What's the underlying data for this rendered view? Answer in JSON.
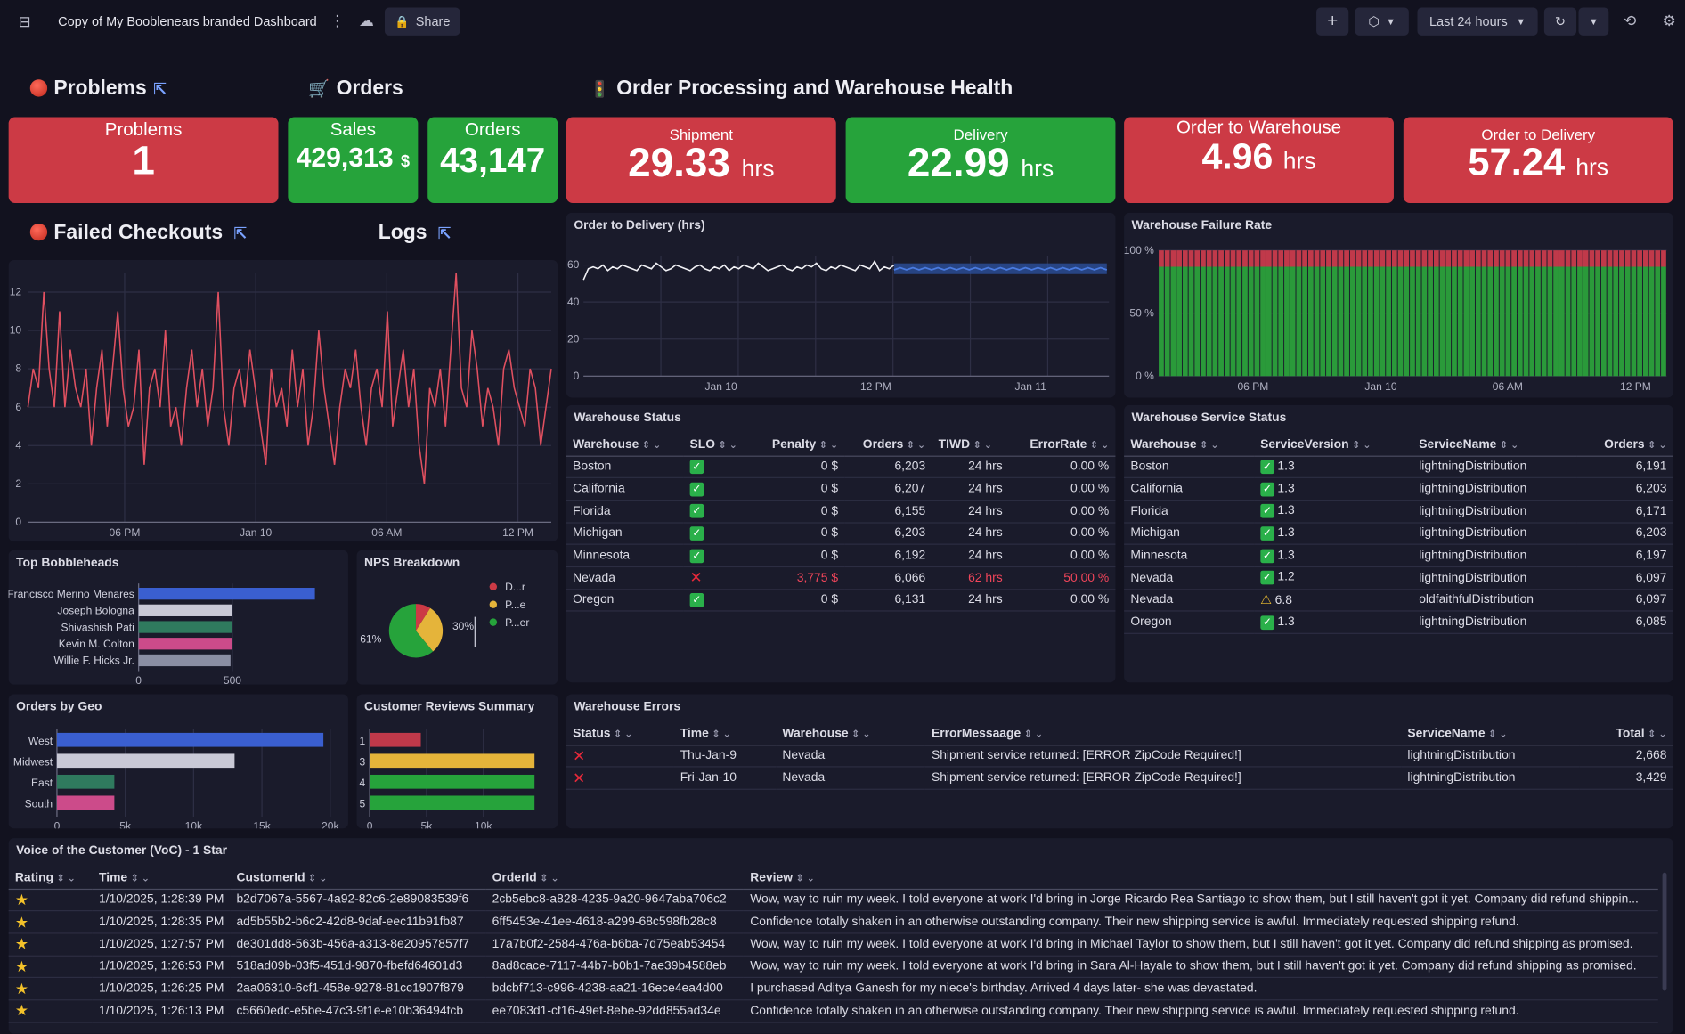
{
  "topbar": {
    "title": "Copy of My Booblenears branded Dashboard",
    "share": "Share",
    "timeframe": "Last 24 hours"
  },
  "headers": {
    "problems": "Problems",
    "orders": "Orders",
    "order_processing": "Order Processing and Warehouse Health",
    "failed_checkouts": "Failed Checkouts",
    "logs": "Logs"
  },
  "kpis": {
    "problems": {
      "label": "Problems",
      "value": "1",
      "color": "#cc3a45"
    },
    "sales": {
      "label": "Sales",
      "value": "429,313",
      "unit": "$",
      "color": "#26a33b"
    },
    "orders": {
      "label": "Orders",
      "value": "43,147",
      "color": "#26a33b"
    },
    "shipment": {
      "label": "Shipment",
      "value": "29.33",
      "unit": "hrs",
      "color": "#cc3a45"
    },
    "delivery": {
      "label": "Delivery",
      "value": "22.99",
      "unit": "hrs",
      "color": "#26a33b"
    },
    "order_to_warehouse": {
      "label": "Order to Warehouse",
      "value": "4.96",
      "unit": "hrs",
      "color": "#cc3a45"
    },
    "order_to_delivery": {
      "label": "Order to Delivery",
      "value": "57.24",
      "unit": "hrs",
      "color": "#cc3a45"
    }
  },
  "tiles": {
    "order_to_delivery": "Order to Delivery (hrs)",
    "warehouse_failure_rate": "Warehouse Failure Rate",
    "warehouse_status": "Warehouse Status",
    "warehouse_service_status": "Warehouse Service Status",
    "top_bobbleheads": "Top Bobbleheads",
    "nps_breakdown": "NPS Breakdown",
    "orders_by_geo": "Orders by Geo",
    "customer_reviews": "Customer Reviews Summary",
    "warehouse_errors": "Warehouse Errors",
    "voc": "Voice of the Customer (VoC) - 1 Star"
  },
  "warehouse_status": {
    "columns": [
      "Warehouse",
      "SLO",
      "Penalty",
      "Orders",
      "TIWD",
      "ErrorRate"
    ],
    "rows": [
      [
        "Boston",
        "ok",
        "0 $",
        "6,203",
        "24 hrs",
        "0.00 %"
      ],
      [
        "California",
        "ok",
        "0 $",
        "6,207",
        "24 hrs",
        "0.00 %"
      ],
      [
        "Florida",
        "ok",
        "0 $",
        "6,155",
        "24 hrs",
        "0.00 %"
      ],
      [
        "Michigan",
        "ok",
        "0 $",
        "6,203",
        "24 hrs",
        "0.00 %"
      ],
      [
        "Minnesota",
        "ok",
        "0 $",
        "6,192",
        "24 hrs",
        "0.00 %"
      ],
      [
        "Nevada",
        "fail",
        "3,775 $",
        "6,066",
        "62 hrs",
        "50.00 %"
      ],
      [
        "Oregon",
        "ok",
        "0 $",
        "6,131",
        "24 hrs",
        "0.00 %"
      ]
    ]
  },
  "warehouse_service_status": {
    "columns": [
      "Warehouse",
      "ServiceVersion",
      "ServiceName",
      "Orders"
    ],
    "rows": [
      [
        "Boston",
        "ok",
        "1.3",
        "lightningDistribution",
        "6,191"
      ],
      [
        "California",
        "ok",
        "1.3",
        "lightningDistribution",
        "6,203"
      ],
      [
        "Florida",
        "ok",
        "1.3",
        "lightningDistribution",
        "6,171"
      ],
      [
        "Michigan",
        "ok",
        "1.3",
        "lightningDistribution",
        "6,203"
      ],
      [
        "Minnesota",
        "ok",
        "1.3",
        "lightningDistribution",
        "6,197"
      ],
      [
        "Nevada",
        "ok",
        "1.2",
        "lightningDistribution",
        "6,097"
      ],
      [
        "Nevada",
        "warn",
        "6.8",
        "oldfaithfulDistribution",
        "6,097"
      ],
      [
        "Oregon",
        "ok",
        "1.3",
        "lightningDistribution",
        "6,085"
      ]
    ]
  },
  "warehouse_errors": {
    "columns": [
      "Status",
      "Time",
      "Warehouse",
      "ErrorMessaage",
      "ServiceName",
      "Total"
    ],
    "rows": [
      [
        "fail",
        "Thu-Jan-9",
        "Nevada",
        "Shipment service returned: [ERROR ZipCode Required!]",
        "lightningDistribution",
        "2,668"
      ],
      [
        "fail",
        "Fri-Jan-10",
        "Nevada",
        "Shipment service returned: [ERROR ZipCode Required!]",
        "lightningDistribution",
        "3,429"
      ]
    ]
  },
  "voc": {
    "columns": [
      "Rating",
      "Time",
      "CustomerId",
      "OrderId",
      "Review"
    ],
    "rows": [
      [
        "1/10/2025, 1:28:39 PM",
        "b2d7067a-5567-4a92-82c6-2e89083539f6",
        "2cb5ebc8-a828-4235-9a20-9647aba706c2",
        "Wow, way to ruin my week. I told everyone at work I'd bring in Jorge Ricardo Rea Santiago to show them, but I still haven't got it yet. Company did refund shippin..."
      ],
      [
        "1/10/2025, 1:28:35 PM",
        "ad5b55b2-b6c2-42d8-9daf-eec11b91fb87",
        "6ff5453e-41ee-4618-a299-68c598fb28c8",
        "Confidence totally shaken in an otherwise outstanding company. Their new shipping service is awful. Immediately requested shipping refund."
      ],
      [
        "1/10/2025, 1:27:57 PM",
        "de301dd8-563b-456a-a313-8e20957857f7",
        "17a7b0f2-2584-476a-b6ba-7d75eab53454",
        "Wow, way to ruin my week. I told everyone at work I'd bring in Michael Taylor to show them, but I still haven't got it yet. Company did refund shipping as promised."
      ],
      [
        "1/10/2025, 1:26:53 PM",
        "518ad09b-03f5-451d-9870-fbefd64601d3",
        "8ad8cace-7117-44b7-b0b1-7ae39b4588eb",
        "Wow, way to ruin my week. I told everyone at work I'd bring in Sara Al-Hayale to show them, but I still haven't got it yet. Company did refund shipping as promised."
      ],
      [
        "1/10/2025, 1:26:25 PM",
        "2aa06310-6cf1-458e-9278-81cc1907f879",
        "bdcbf713-c996-4238-aa21-16ece4ea4d00",
        "I purchased Aditya Ganesh for my niece's birthday. Arrived 4 days later- she was devastated."
      ],
      [
        "1/10/2025, 1:26:13 PM",
        "c5660edc-e5be-47c3-9f1e-e10b36494fcb",
        "ee7083d1-cf16-49ef-8ebe-92dd855ad34e",
        "Confidence totally shaken in an otherwise outstanding company. Their new shipping service is awful. Immediately requested shipping refund."
      ]
    ]
  },
  "chart_data": [
    {
      "type": "line",
      "id": "failed_checkouts",
      "title": "",
      "x_ticks": [
        "06 PM",
        "Jan 10",
        "06 AM",
        "12 PM"
      ],
      "ylim": [
        0,
        13
      ],
      "y_ticks": [
        0,
        2,
        4,
        6,
        8,
        10,
        12
      ],
      "color": "#e05060",
      "values": [
        6,
        8,
        7,
        12,
        8,
        6,
        11,
        6,
        9,
        7,
        6,
        8,
        4,
        7,
        9,
        5,
        8,
        11,
        7,
        5,
        6,
        9,
        3,
        7,
        8,
        6,
        10,
        5,
        6,
        4,
        7,
        9,
        6,
        8,
        5,
        7,
        12,
        6,
        4,
        7,
        8,
        6,
        9,
        7,
        5,
        3,
        8,
        6,
        7,
        5,
        9,
        6,
        8,
        4,
        6,
        10,
        7,
        5,
        3,
        6,
        8,
        7,
        9,
        6,
        4,
        7,
        8,
        6,
        11,
        5,
        7,
        9,
        6,
        8,
        4,
        2,
        7,
        6,
        8,
        5,
        9,
        13,
        7,
        6,
        10,
        8,
        5,
        7,
        6,
        4,
        8,
        9,
        7,
        6,
        5,
        8,
        7,
        4,
        6,
        8
      ]
    },
    {
      "type": "area",
      "id": "order_to_delivery",
      "title": "Order to Delivery (hrs)",
      "x_ticks": [
        "Jan 10",
        "12 PM",
        "Jan 11"
      ],
      "ylim": [
        0,
        65
      ],
      "y_ticks": [
        0,
        20,
        40,
        60
      ],
      "series": [
        {
          "name": "actual",
          "values": [
            52,
            58,
            59,
            58,
            60,
            57,
            59,
            58,
            60,
            59,
            58,
            57,
            60,
            59,
            58,
            61,
            59,
            57,
            58,
            60,
            59,
            58,
            57,
            59,
            60,
            58,
            57,
            59,
            58,
            60,
            57,
            59,
            58,
            60,
            59,
            58,
            61,
            59,
            57,
            58,
            59,
            60,
            58,
            57,
            59,
            58,
            60,
            59,
            61,
            58,
            57,
            59,
            58,
            60,
            59,
            58,
            57,
            60,
            59,
            58,
            62,
            57,
            59,
            58,
            60
          ]
        },
        {
          "name": "forecast",
          "values": [
            58,
            58,
            58,
            58,
            58,
            58,
            58,
            58,
            58,
            58,
            58,
            58,
            58,
            58,
            58,
            58,
            58,
            58,
            58,
            58,
            58,
            58,
            58,
            58,
            58,
            58,
            58,
            58,
            58,
            58,
            58,
            58,
            58,
            58,
            58
          ]
        }
      ]
    },
    {
      "type": "bar",
      "id": "warehouse_failure_rate",
      "title": "Warehouse Failure Rate",
      "x_ticks": [
        "06 PM",
        "Jan 10",
        "06 AM",
        "12 PM"
      ],
      "y_ticks": [
        "0 %",
        "50 %",
        "100 %"
      ],
      "stacked": true,
      "ok_fraction": 0.87,
      "fail_fraction": 0.13,
      "bars": 85
    },
    {
      "type": "bar",
      "id": "top_bobbleheads",
      "title": "Top Bobbleheads",
      "orientation": "horizontal",
      "categories": [
        "Francisco Merino Menares",
        "Joseph Bologna",
        "Shivashish Pati",
        "Kevin M. Colton",
        "Willie F. Hicks Jr."
      ],
      "values": [
        940,
        500,
        500,
        500,
        490
      ],
      "colors": [
        "#3a5fd0",
        "#c9c9d6",
        "#2f7a5e",
        "#cc4b8a",
        "#8a8ea3"
      ],
      "x_ticks": [
        0,
        500
      ],
      "xlim": [
        0,
        1060
      ]
    },
    {
      "type": "pie",
      "id": "nps_breakdown",
      "title": "NPS Breakdown",
      "labels": [
        "D...r",
        "P...e",
        "P...er"
      ],
      "values": [
        9,
        30,
        61
      ],
      "colors": [
        "#cc3a45",
        "#e5b43a",
        "#26a33b"
      ],
      "percent_labels": [
        "61%",
        "30%"
      ]
    },
    {
      "type": "bar",
      "id": "orders_by_geo",
      "title": "Orders by Geo",
      "orientation": "horizontal",
      "categories": [
        "West",
        "Midwest",
        "East",
        "South"
      ],
      "values": [
        19500,
        13000,
        4200,
        4200
      ],
      "colors": [
        "#3a5fd0",
        "#c9c9d6",
        "#2f7a5e",
        "#cc4b8a"
      ],
      "x_ticks": [
        "0",
        "5k",
        "10k",
        "15k",
        "20k"
      ],
      "xlim": [
        0,
        21000
      ]
    },
    {
      "type": "bar",
      "id": "customer_reviews",
      "title": "Customer Reviews Summary",
      "orientation": "horizontal",
      "categories": [
        "1",
        "3",
        "4",
        "5"
      ],
      "values": [
        4500,
        14500,
        14500,
        14500
      ],
      "colors": [
        "#c0394a",
        "#e5b43a",
        "#26a33b",
        "#26a33b"
      ],
      "x_ticks": [
        "0",
        "5k",
        "10k"
      ],
      "xlim": [
        0,
        15500
      ]
    }
  ]
}
